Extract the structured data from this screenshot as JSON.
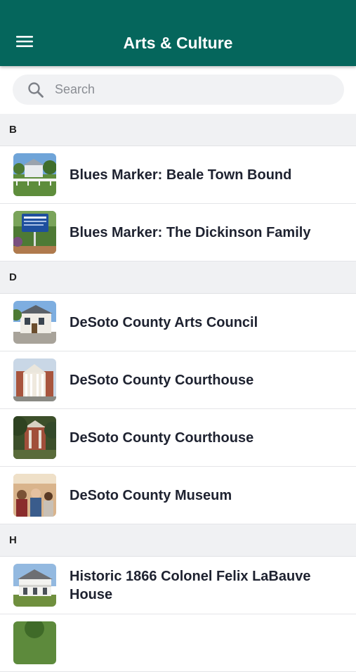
{
  "header": {
    "title": "Arts & Culture",
    "menu_icon": "hamburger-menu-icon",
    "background": "#05665c"
  },
  "search": {
    "placeholder": "Search",
    "value": "",
    "icon": "search-icon"
  },
  "sections": [
    {
      "letter": "B",
      "items": [
        {
          "label": "Blues Marker: Beale Town Bound",
          "thumb": "house-photo"
        },
        {
          "label": "Blues Marker: The Dickinson Family",
          "thumb": "marker-sign-photo"
        }
      ]
    },
    {
      "letter": "D",
      "items": [
        {
          "label": "DeSoto County Arts Council",
          "thumb": "building-photo"
        },
        {
          "label": "DeSoto County Courthouse",
          "thumb": "courthouse-photo"
        },
        {
          "label": "DeSoto County Courthouse",
          "thumb": "courthouse-trees-photo"
        },
        {
          "label": "DeSoto County Museum",
          "thumb": "museum-crowd-photo"
        }
      ]
    },
    {
      "letter": "H",
      "items": [
        {
          "label": "Historic 1866 Colonel Felix LaBauve House",
          "thumb": "victorian-house-photo"
        }
      ]
    }
  ]
}
